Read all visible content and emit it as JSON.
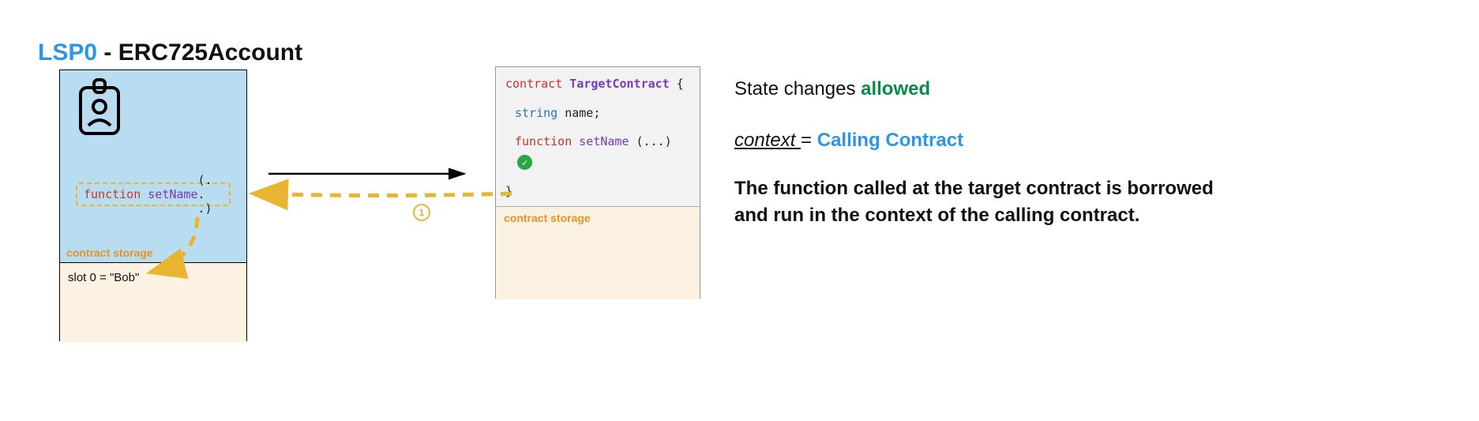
{
  "title": {
    "lsp": "LSP0",
    "rest": " - ERC725Account"
  },
  "left_card": {
    "storage_label": "contract storage",
    "fn": {
      "keyword": "function",
      "name": "setName",
      "params": "(. . .)"
    },
    "slot_text": "slot 0 = \"Bob\""
  },
  "right_card": {
    "line1": {
      "kw": "contract",
      "name": "TargetContract",
      "brace": " {"
    },
    "line2": {
      "type": "string",
      "var": " name;"
    },
    "line3": {
      "kw": "function",
      "name": "setName",
      "params": "(...)"
    },
    "line4": "}",
    "storage_label": "contract storage"
  },
  "explain": {
    "line1a": "State changes ",
    "line1b": "allowed",
    "line2a": "context ",
    "line2b": "= ",
    "line2c": "Calling Contract",
    "para": "The function called at the target contract is borrowed and run in the context of the calling contract."
  },
  "step": "1"
}
